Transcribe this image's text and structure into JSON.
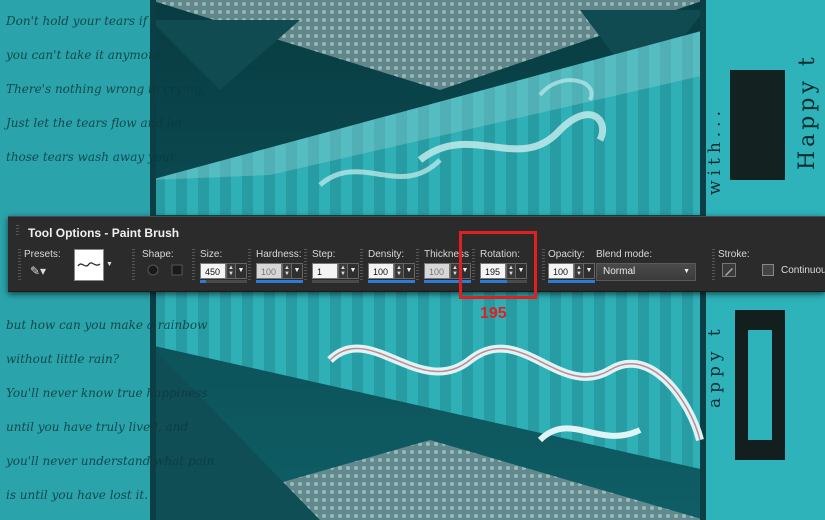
{
  "background": {
    "script_lines": [
      "Don't hold your tears if",
      "you can't take it anymore.",
      "There's nothing wrong in crying,",
      "Just let the tears flow and let",
      "those tears wash away your",
      "but how can you make a rainbow",
      "without little rain?",
      "You'll never know true happiness",
      "until you have truly lived, and",
      "you'll never understand what pain",
      "is until you have lost it."
    ],
    "vertical_text_large": "Happy t",
    "vertical_text_small": "with...",
    "vertical_text_small_2": "appy t",
    "colors": {
      "teal": "#2aa6ad",
      "dark_teal": "#0b4d54",
      "light_teal": "#7fd4d4"
    }
  },
  "tool_options": {
    "title": "Tool Options - Paint Brush",
    "presets": {
      "label": "Presets:"
    },
    "shape": {
      "label": "Shape:"
    },
    "size": {
      "label": "Size:",
      "value": "450",
      "fill": 0.12
    },
    "hardness": {
      "label": "Hardness:",
      "value": "100"
    },
    "step": {
      "label": "Step:",
      "value": "1"
    },
    "density": {
      "label": "Density:",
      "value": "100"
    },
    "thickness": {
      "label": "Thickness",
      "value": "100"
    },
    "rotation": {
      "label": "Rotation:",
      "value": "195"
    },
    "opacity": {
      "label": "Opacity:",
      "value": "100"
    },
    "blend_mode": {
      "label": "Blend mode:",
      "value": "Normal"
    },
    "stroke": {
      "label": "Stroke:"
    },
    "continuous": {
      "label": "Continuous"
    }
  },
  "annotation": {
    "label": "195",
    "color": "#e02020"
  }
}
